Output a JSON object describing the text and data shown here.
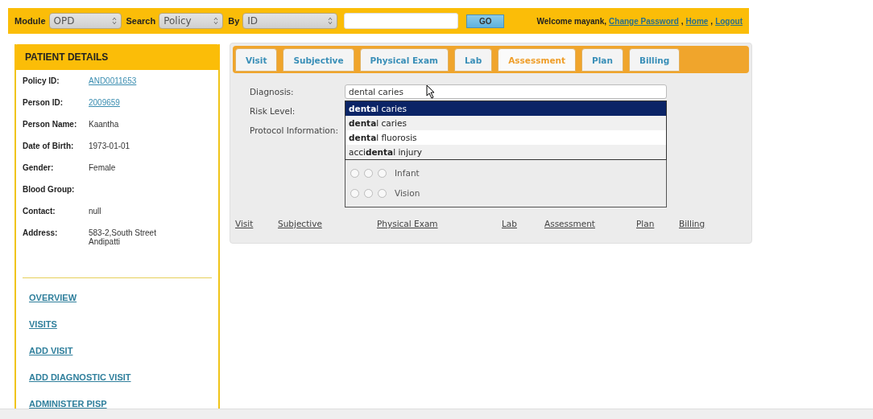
{
  "top_bar": {
    "module_label": "Module",
    "module_value": "OPD",
    "search_label": "Search",
    "search_value": "Policy",
    "by_label": "By",
    "by_value": "ID",
    "go": "GO",
    "welcome": "Welcome mayank,",
    "links": [
      "Change Password",
      "Home",
      "Logout"
    ],
    "separator": ","
  },
  "patient_details": {
    "title": "PATIENT DETAILS",
    "fields": [
      {
        "label": "Policy ID:",
        "value": "AND0011653",
        "kind": "link"
      },
      {
        "label": "Person ID:",
        "value": "2009659",
        "kind": "link"
      },
      {
        "label": "Person Name:",
        "value": "Kaantha",
        "kind": "text"
      },
      {
        "label": "Date of Birth:",
        "value": "1973-01-01",
        "kind": "text"
      },
      {
        "label": "Gender:",
        "value": "Female",
        "kind": "text"
      },
      {
        "label": "Blood Group:"
      },
      {
        "label": "Contact:",
        "value": "null",
        "kind": "text"
      },
      {
        "label": "Address:",
        "value": "583-2,South Street Andipatti",
        "kind": "text"
      }
    ],
    "nav": [
      "OVERVIEW",
      "VISITS",
      "ADD VISIT",
      "ADD DIAGNOSTIC VISIT",
      "ADMINISTER PISP"
    ]
  },
  "tabs": [
    {
      "label": "Visit",
      "selected": false
    },
    {
      "label": "Subjective",
      "selected": false
    },
    {
      "label": "Physical Exam",
      "selected": false
    },
    {
      "label": "Lab",
      "selected": false
    },
    {
      "label": "Assessment",
      "selected": true
    },
    {
      "label": "Plan",
      "selected": false
    },
    {
      "label": "Billing",
      "selected": false
    }
  ],
  "form": {
    "diagnosis_label": "Diagnosis:",
    "diagnosis_value": "dental caries",
    "risk_label": "Risk Level:",
    "protocol_label": "Protocol Information:",
    "suggestions": [
      {
        "text": "**denta**l caries",
        "selected": true
      },
      {
        "text": "**denta**l caries",
        "selected": false
      },
      {
        "text": "**denta**l fluorosis",
        "selected": false
      },
      {
        "text": "acci**denta**l injury",
        "selected": false
      }
    ],
    "protocols": [
      {
        "label": "Infant",
        "radios": [
          {
            "checked": false
          },
          {
            "checked": false
          },
          {
            "checked": false
          }
        ]
      },
      {
        "label": "Vision",
        "radios": [
          {
            "checked": false
          },
          {
            "checked": false
          },
          {
            "checked": false
          }
        ]
      }
    ]
  },
  "bottom_links": [
    "Visit",
    "Subjective",
    "Physical Exam",
    "Lab",
    "Assessment",
    "Plan",
    "Billing"
  ]
}
